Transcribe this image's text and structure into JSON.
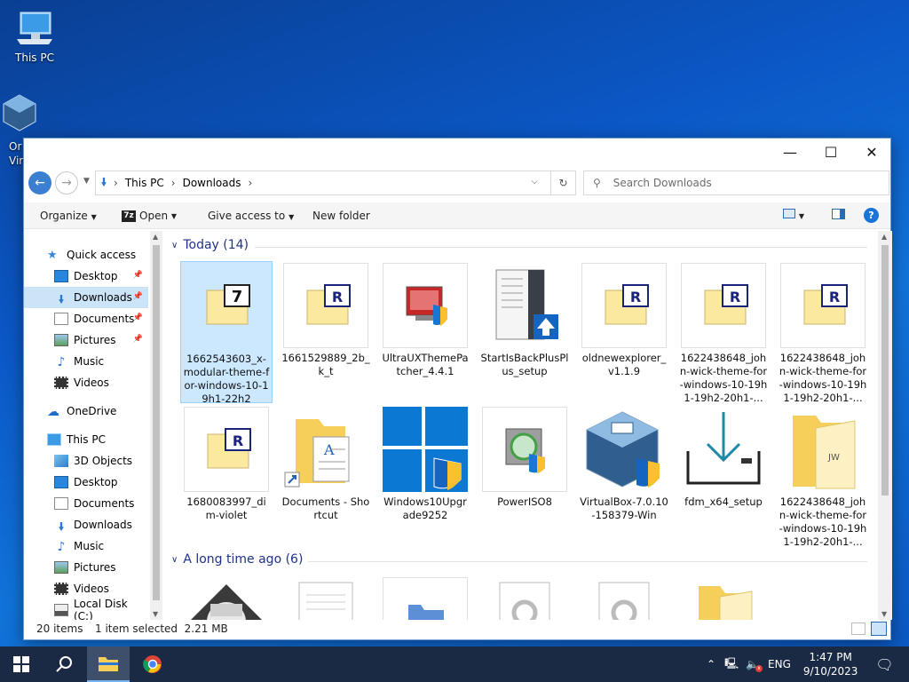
{
  "desktop": {
    "icons": [
      {
        "label": "This PC",
        "icon": "this-pc-icon"
      },
      {
        "label": "Or",
        "icon": "virtualbox-icon"
      },
      {
        "label": "Vir",
        "icon": ""
      }
    ]
  },
  "window": {
    "controls": {
      "minimize": "—",
      "maximize": "☐",
      "close": "✕"
    },
    "address": {
      "parts": [
        "This PC",
        "Downloads"
      ],
      "separator": "›"
    },
    "search": {
      "placeholder": "Search Downloads"
    },
    "commands": {
      "organize": "Organize",
      "open": "Open",
      "give_access": "Give access to",
      "new_folder": "New folder"
    },
    "nav": [
      {
        "label": "Quick access",
        "icon": "star-icon"
      },
      {
        "label": "Desktop",
        "icon": "desktop-folder-icon",
        "pinned": true
      },
      {
        "label": "Downloads",
        "icon": "download-arrow-icon",
        "pinned": true,
        "selected": true
      },
      {
        "label": "Documents",
        "icon": "documents-icon",
        "pinned": true
      },
      {
        "label": "Pictures",
        "icon": "pictures-icon",
        "pinned": true
      },
      {
        "label": "Music",
        "icon": "music-note-icon"
      },
      {
        "label": "Videos",
        "icon": "videos-icon"
      },
      {
        "label": "OneDrive",
        "icon": "cloud-icon"
      },
      {
        "label": "This PC",
        "icon": "this-pc-icon"
      },
      {
        "label": "3D Objects",
        "icon": "cube-icon"
      },
      {
        "label": "Desktop",
        "icon": "desktop-folder-icon"
      },
      {
        "label": "Documents",
        "icon": "documents-icon"
      },
      {
        "label": "Downloads",
        "icon": "download-arrow-icon"
      },
      {
        "label": "Music",
        "icon": "music-note-icon"
      },
      {
        "label": "Pictures",
        "icon": "pictures-icon"
      },
      {
        "label": "Videos",
        "icon": "videos-icon"
      },
      {
        "label": "Local Disk (C:)",
        "icon": "drive-icon"
      }
    ],
    "groups": [
      {
        "title": "Today (14)"
      },
      {
        "title": "A long time ago (6)"
      }
    ],
    "items": [
      {
        "label": "1662543603_x-modular-theme-for-windows-10-19h1-22h2",
        "icon": "7zip-archive-icon",
        "selected": true
      },
      {
        "label": "1661529889_2b_k_t",
        "icon": "winrar-archive-icon"
      },
      {
        "label": "UltraUXThemePatcher_4.4.1",
        "icon": "installer-shield-icon"
      },
      {
        "label": "StartIsBackPlusPlus_setup",
        "icon": "setup-icon"
      },
      {
        "label": "oldnewexplorer_v1.1.9",
        "icon": "winrar-archive-icon"
      },
      {
        "label": "1622438648_john-wick-theme-for-windows-10-19h1-19h2-20h1-...",
        "icon": "winrar-archive-icon"
      },
      {
        "label": "1622438648_john-wick-theme-for-windows-10-19h1-19h2-20h1-...",
        "icon": "winrar-archive-icon"
      },
      {
        "label": "1680083997_dim-violet",
        "icon": "winrar-archive-icon"
      },
      {
        "label": "Documents - Shortcut",
        "icon": "folder-shortcut-icon"
      },
      {
        "label": "Windows10Upgrade9252",
        "icon": "windows-logo-icon"
      },
      {
        "label": "PowerISO8",
        "icon": "poweriso-icon"
      },
      {
        "label": "VirtualBox-7.0.10-158379-Win",
        "icon": "virtualbox-icon"
      },
      {
        "label": "fdm_x64_setup",
        "icon": "download-tray-icon"
      },
      {
        "label": "1622438648_john-wick-theme-for-windows-10-19h1-19h2-20h1-...",
        "icon": "folder-icon"
      }
    ],
    "status": {
      "count": "20 items",
      "selection": "1 item selected  2.21 MB"
    }
  },
  "taskbar": {
    "apps": [
      {
        "icon": "windows-start-icon"
      },
      {
        "icon": "search-icon"
      },
      {
        "icon": "file-explorer-icon"
      },
      {
        "icon": "chrome-icon"
      }
    ],
    "tray": {
      "lang": "ENG",
      "time": "1:47 PM",
      "date": "9/10/2023"
    }
  },
  "colors": {
    "accent": "#0078d7",
    "selection": "#cce8ff",
    "taskbar": "#1a2a44"
  }
}
